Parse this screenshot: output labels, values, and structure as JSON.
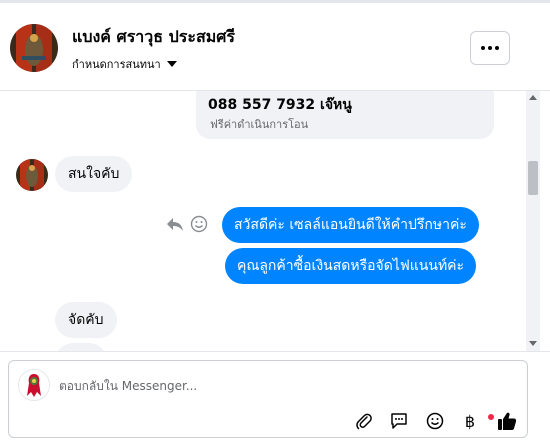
{
  "header": {
    "contact_name": "แบงค์ ศราวุธ ประสมศรี",
    "subtitle": "กำหนดการสนทนา",
    "more_label": "More options"
  },
  "messages": {
    "card": {
      "phone": "088 557 7932 เจ๊หนู",
      "note": "ฟรีค่าดำเนินการโอน"
    },
    "incoming_1": "สนใจคับ",
    "outgoing_1": "สวัสดีค่ะ เซลล์แอนยินดีให้คำปรึกษาค่ะ",
    "outgoing_2": "คุณลูกค้าซื้อเงินสดหรือจัดไฟแนนท์ค่ะ",
    "incoming_2": "จัดคับ"
  },
  "composer": {
    "placeholder": "ตอบกลับใน Messenger...",
    "tools": [
      "paperclip-icon",
      "speech-bubble-icon",
      "smile-icon",
      "baht-icon",
      "thumbs-up-icon"
    ],
    "baht_symbol": "฿"
  },
  "colors": {
    "accent": "#0084ff",
    "incoming_bubble": "#f0f2f5",
    "notification": "#f02849"
  }
}
